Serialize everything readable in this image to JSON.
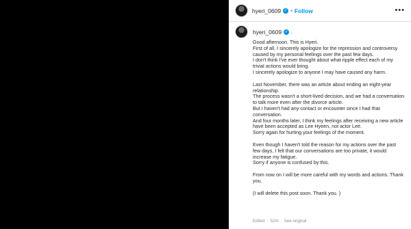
{
  "post": {
    "username": "hyeri_0609",
    "separator": "•",
    "follow_label": "Follow",
    "more_glyph": "•••",
    "caption_separator": "."
  },
  "caption": {
    "paragraphs": [
      [
        "Good afternoon. This is Hyeri.",
        "First of all, I sincerely apologize for the repression and controversy caused by my personal feelings over the past few days.",
        "I don't think I've ever thought about what ripple effect each of my trivial actions would bring.",
        "I sincerely apologize to anyone I may have caused any harm."
      ],
      [
        "Last November, there was an article about ending an eight-year relationship.",
        "The process wasn't a short-lived decision, and we had a conversation to talk more even after the divorce article.",
        "But I haven't had any contact or encounter since I had that conversation.",
        "And four months later, I think my feelings after receiving a new article have been accepted as Lee Hyeen, not actor Lee.",
        "Sorry again for hurting your feelings of the moment."
      ],
      [
        "Even though I haven't told the reason for my actions over the past few days, I felt that our conversations are too private, it would increase my fatigue.",
        "Sorry if anyone is confused by this."
      ],
      [
        "From now on I will be more careful with my words and actions. Thank you."
      ],
      [
        "(I will delete this post soon. Thank you. )"
      ]
    ]
  },
  "footer": {
    "edited": "Edited",
    "separator": "·",
    "time": "52m",
    "see_original": "See original"
  }
}
